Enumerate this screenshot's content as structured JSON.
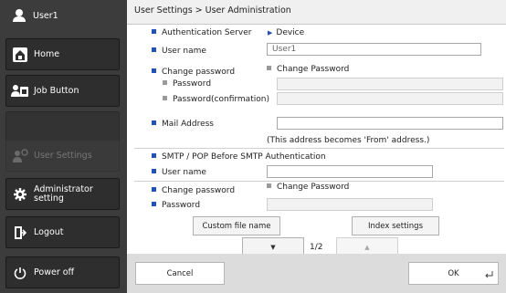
{
  "sidebar": {
    "user": "User1",
    "items": [
      {
        "label": "Home",
        "icon": "home-icon"
      },
      {
        "label": "Job Button",
        "icon": "job-button-icon"
      },
      {
        "label": "",
        "icon": ""
      },
      {
        "label": "User Settings",
        "icon": "user-settings-icon",
        "disabled": true
      },
      {
        "label": "Administrator\nsetting",
        "icon": "gear-icon"
      },
      {
        "label": "Logout",
        "icon": "logout-icon"
      },
      {
        "label": "Power off",
        "icon": "power-icon"
      }
    ]
  },
  "breadcrumb": "User Settings > User Administration",
  "form": {
    "auth_server_label": "Authentication Server",
    "auth_server_value": "Device",
    "user_name_label": "User name",
    "user_name_value": "User1",
    "change_password_label": "Change password",
    "change_password_check": "Change Password",
    "password_label": "Password",
    "password_confirm_label": "Password(confirmation)",
    "mail_label": "Mail Address",
    "mail_note": "(This address becomes 'From' address.)",
    "smtp_section": "SMTP / POP Before SMTP Authentication",
    "smtp_user_label": "User name",
    "smtp_change_label": "Change password",
    "smtp_change_check": "Change Password",
    "smtp_password_label": "Password"
  },
  "buttons": {
    "custom_file_name": "Custom file name",
    "index_settings": "Index settings",
    "page_down": "▼",
    "page_up": "▲",
    "page_indicator": "1/2",
    "cancel": "Cancel",
    "ok": "OK"
  },
  "colors": {
    "sidebar_bg": "#3c3c3c",
    "accent": "#1e50c8"
  }
}
